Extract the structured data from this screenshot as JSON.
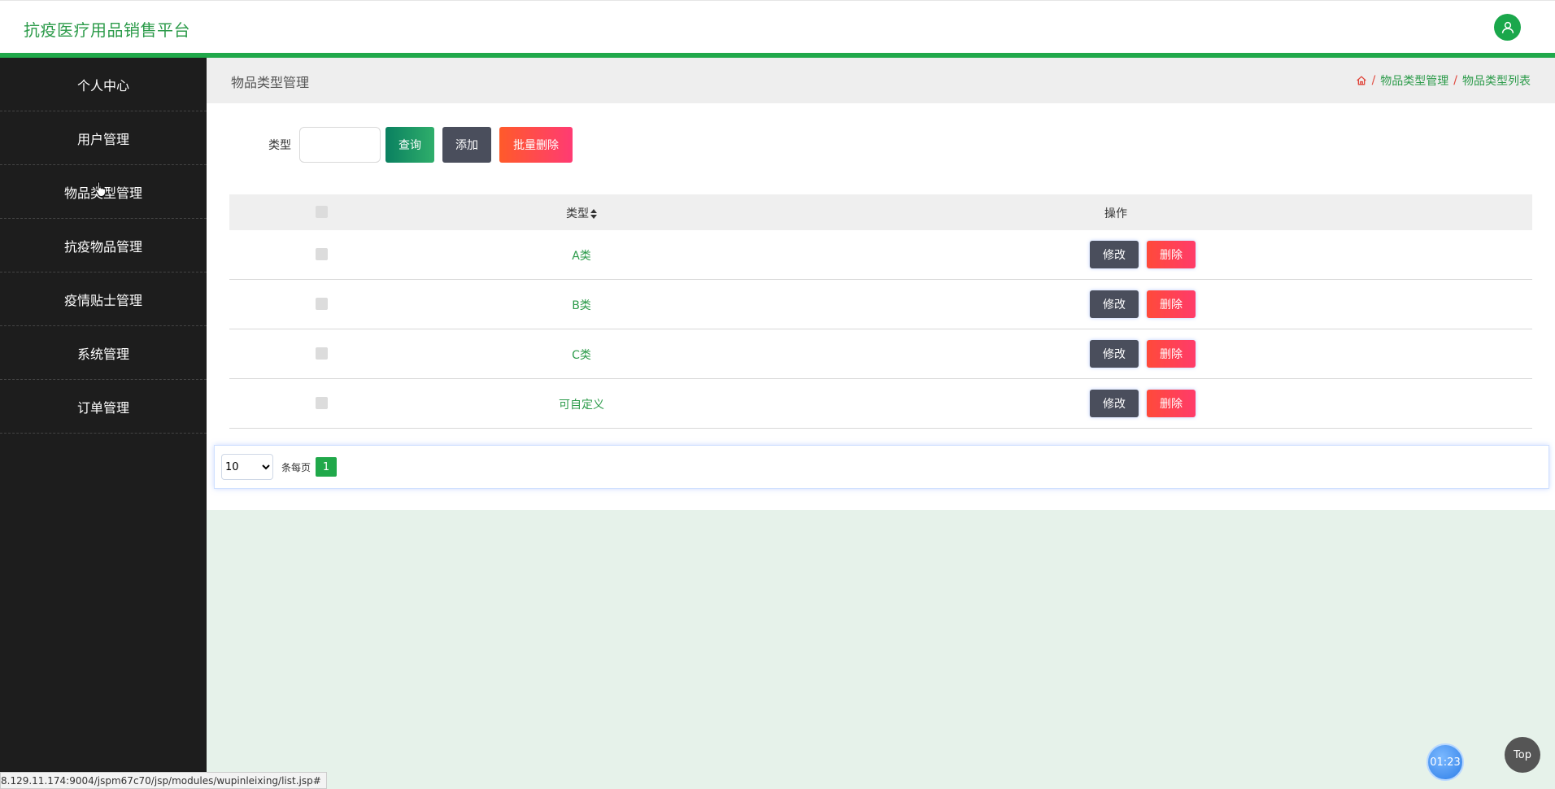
{
  "app": {
    "title": "抗疫医疗用品销售平台"
  },
  "sidebar": {
    "items": [
      {
        "label": "个人中心"
      },
      {
        "label": "用户管理"
      },
      {
        "label": "物品类型管理"
      },
      {
        "label": "抗疫物品管理"
      },
      {
        "label": "疫情贴士管理"
      },
      {
        "label": "系统管理"
      },
      {
        "label": "订单管理"
      }
    ]
  },
  "page": {
    "title": "物品类型管理",
    "breadcrumb": [
      "物品类型管理",
      "物品类型列表"
    ]
  },
  "search": {
    "label": "类型",
    "value": "",
    "query_label": "查询",
    "add_label": "添加",
    "batch_delete_label": "批量删除"
  },
  "table": {
    "headers": {
      "type": "类型",
      "ops": "操作"
    },
    "rows": [
      {
        "type": "A类",
        "edit": "修改",
        "delete": "删除"
      },
      {
        "type": "B类",
        "edit": "修改",
        "delete": "删除"
      },
      {
        "type": "C类",
        "edit": "修改",
        "delete": "删除"
      },
      {
        "type": "可自定义",
        "edit": "修改",
        "delete": "删除"
      }
    ]
  },
  "pager": {
    "page_size": "10",
    "per_page_label": "条每页",
    "current_page": "1"
  },
  "widgets": {
    "timer": "01:23",
    "top": "Top"
  },
  "status": {
    "url": "8.129.11.174:9004/jspm67c70/jsp/modules/wupinleixing/list.jsp#"
  },
  "colors": {
    "accent": "#20a84a",
    "sidebar": "#1d1d1d",
    "danger": "#ff4a3a"
  }
}
